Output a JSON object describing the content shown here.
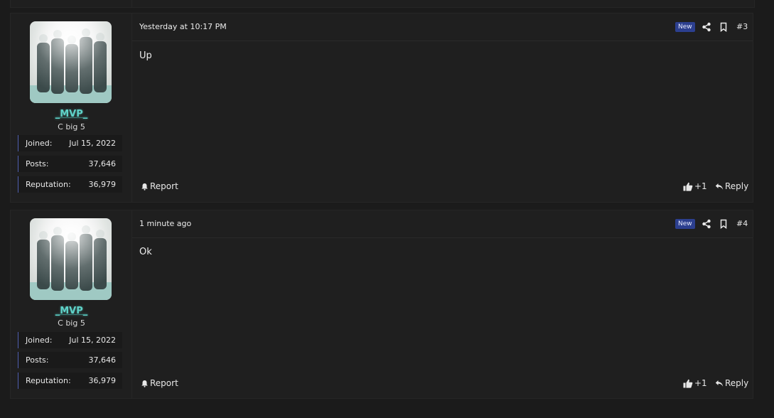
{
  "posts": [
    {
      "number": "#3",
      "date": "Yesterday at 10:17 PM",
      "badge": "New",
      "content": "Up",
      "user": {
        "name": "_MVP_",
        "title": "C big 5",
        "stats": [
          {
            "label": "Joined:",
            "value": "Jul 15, 2022"
          },
          {
            "label": "Posts:",
            "value": "37,646"
          },
          {
            "label": "Reputation:",
            "value": "36,979"
          }
        ]
      },
      "actions": {
        "report": "Report",
        "like": "+1",
        "reply": "Reply"
      }
    },
    {
      "number": "#4",
      "date": "1 minute ago",
      "badge": "New",
      "content": "Ok",
      "user": {
        "name": "_MVP_",
        "title": "C big 5",
        "stats": [
          {
            "label": "Joined:",
            "value": "Jul 15, 2022"
          },
          {
            "label": "Posts:",
            "value": "37,646"
          },
          {
            "label": "Reputation:",
            "value": "36,979"
          }
        ]
      },
      "actions": {
        "report": "Report",
        "like": "+1",
        "reply": "Reply"
      }
    }
  ],
  "icons": {
    "share": "share-icon",
    "bookmark": "bookmark-icon",
    "report": "bell-icon",
    "like": "thumbs-up-icon",
    "reply": "reply-icon"
  },
  "colors": {
    "background": "#1b1b1b",
    "panel": "#1f1f1f",
    "username": "#5fd3c9",
    "badge": "#2c3f8f",
    "stat_accent": "#4f5fb0"
  }
}
